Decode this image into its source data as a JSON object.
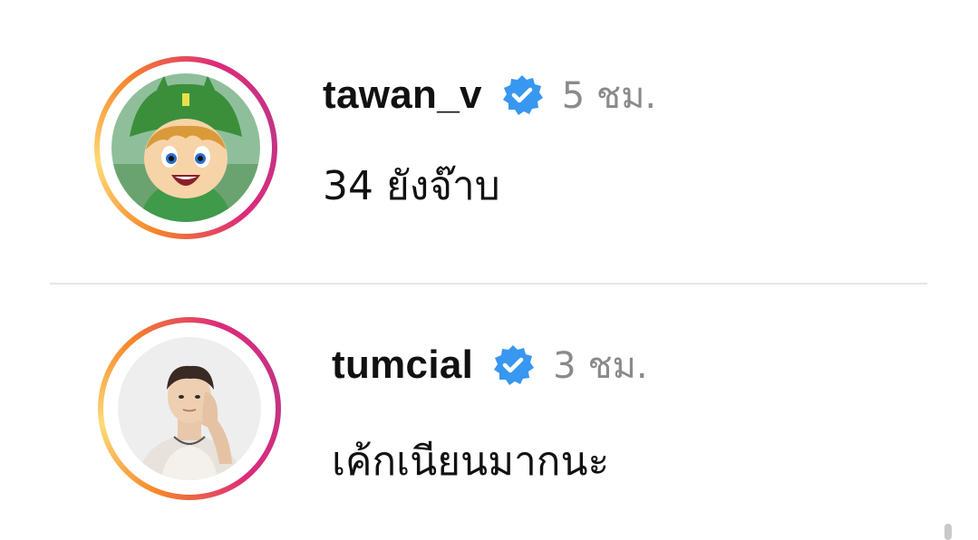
{
  "comments": [
    {
      "username": "tawan_v",
      "verified": true,
      "verified_icon": "verified-badge-icon",
      "time": "5 ชม.",
      "text": "34 ยังจ๊าบ",
      "avatar": "cartoon-avatar"
    },
    {
      "username": "tumcial",
      "verified": true,
      "verified_icon": "verified-badge-icon",
      "time": "3 ชม.",
      "text": "เค้กเนียนมากนะ",
      "avatar": "photo-avatar"
    }
  ],
  "colors": {
    "verified": "#3897f0",
    "ring_start": "#f58529",
    "ring_end": "#c13584",
    "time_text": "#8a8a8a",
    "divider": "#e6e6e6"
  }
}
